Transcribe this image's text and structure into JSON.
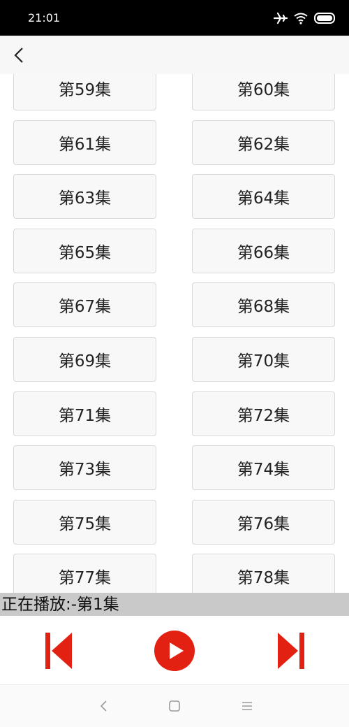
{
  "status_bar": {
    "time": "21:01",
    "icons": [
      "airplane-icon",
      "wifi-icon",
      "battery-icon"
    ]
  },
  "header": {
    "back_icon": "chevron-left-icon"
  },
  "episodes": [
    "第59集",
    "第60集",
    "第61集",
    "第62集",
    "第63集",
    "第64集",
    "第65集",
    "第66集",
    "第67集",
    "第68集",
    "第69集",
    "第70集",
    "第71集",
    "第72集",
    "第73集",
    "第74集",
    "第75集",
    "第76集",
    "第77集",
    "第78集"
  ],
  "now_playing": {
    "text": "正在播放:-第1集"
  },
  "controls": {
    "accent_color": "#e32113",
    "icons": [
      "skip-previous-icon",
      "play-icon",
      "skip-next-icon"
    ]
  },
  "nav_bar": {
    "icons": [
      "nav-back-icon",
      "nav-home-icon",
      "nav-menu-icon"
    ]
  }
}
